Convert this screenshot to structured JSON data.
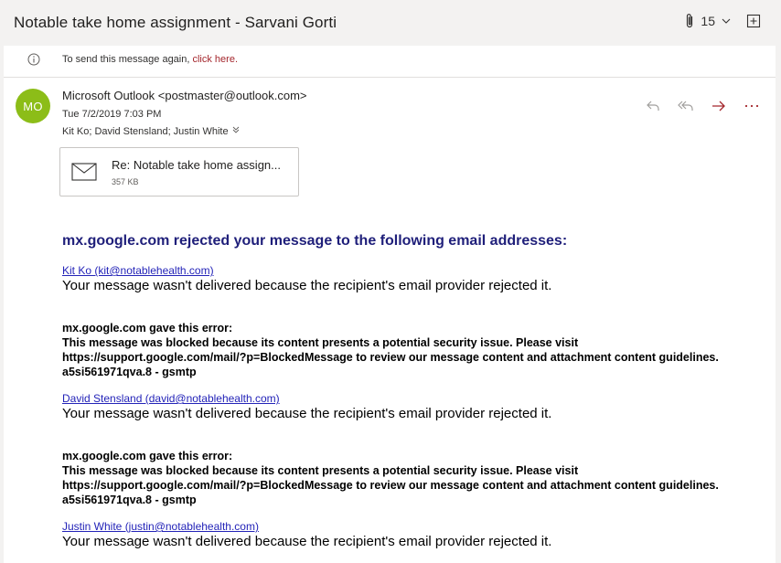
{
  "window": {
    "title": "Notable take home assignment - Sarvani Gorti",
    "attachment_count": "15"
  },
  "notice": {
    "text": "To send this message again,",
    "link": "click here."
  },
  "message": {
    "avatar_initials": "MO",
    "avatar_color": "#8cbd18",
    "sender": "Microsoft Outlook <postmaster@outlook.com>",
    "date": "Tue 7/2/2019 7:03 PM",
    "recipients": "Kit Ko; David Stensland; Justin White"
  },
  "actions": [
    "reply-icon",
    "reply-all-icon",
    "forward-icon",
    "more-icon"
  ],
  "attachment": {
    "name": "Re: Notable take home assign...",
    "size": "357 KB"
  },
  "body": {
    "headline": "mx.google.com rejected your message to the following email addresses:",
    "entries": [
      {
        "link": "Kit Ko (kit@notablehealth.com)",
        "message": "Your message wasn't delivered because the recipient's email provider rejected it."
      },
      {
        "error_title": "mx.google.com gave this error:",
        "error_text": "This message was blocked because its content presents a potential security issue. Please visit https://support.google.com/mail/?p=BlockedMessage to review our message content and attachment content guidelines. a5si561971qva.8 - gsmtp",
        "link": "David Stensland (david@notablehealth.com)",
        "message": "Your message wasn't delivered because the recipient's email provider rejected it."
      },
      {
        "error_title": "mx.google.com gave this error:",
        "error_text": "This message was blocked because its content presents a potential security issue. Please visit https://support.google.com/mail/?p=BlockedMessage to review our message content and attachment content guidelines. a5si561971qva.8 - gsmtp",
        "link": "Justin White (justin@notablehealth.com)",
        "message": "Your message wasn't delivered because the recipient's email provider rejected it."
      }
    ]
  },
  "colors": {
    "accent": "#a4262c",
    "link": "#2323b8",
    "headline": "#1f1f7a"
  }
}
